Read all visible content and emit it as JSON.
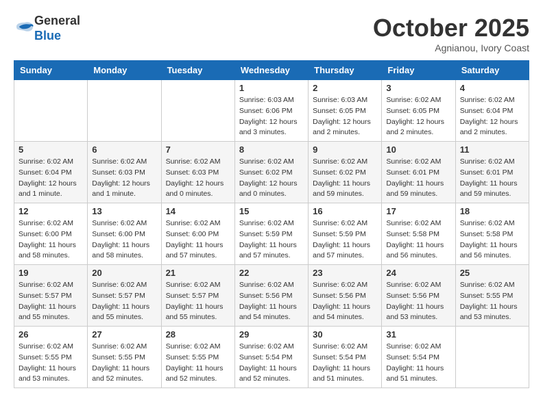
{
  "header": {
    "logo_general": "General",
    "logo_blue": "Blue",
    "month": "October 2025",
    "location": "Agnianou, Ivory Coast"
  },
  "weekdays": [
    "Sunday",
    "Monday",
    "Tuesday",
    "Wednesday",
    "Thursday",
    "Friday",
    "Saturday"
  ],
  "weeks": [
    [
      {
        "day": "",
        "info": ""
      },
      {
        "day": "",
        "info": ""
      },
      {
        "day": "",
        "info": ""
      },
      {
        "day": "1",
        "info": "Sunrise: 6:03 AM\nSunset: 6:06 PM\nDaylight: 12 hours\nand 3 minutes."
      },
      {
        "day": "2",
        "info": "Sunrise: 6:03 AM\nSunset: 6:05 PM\nDaylight: 12 hours\nand 2 minutes."
      },
      {
        "day": "3",
        "info": "Sunrise: 6:02 AM\nSunset: 6:05 PM\nDaylight: 12 hours\nand 2 minutes."
      },
      {
        "day": "4",
        "info": "Sunrise: 6:02 AM\nSunset: 6:04 PM\nDaylight: 12 hours\nand 2 minutes."
      }
    ],
    [
      {
        "day": "5",
        "info": "Sunrise: 6:02 AM\nSunset: 6:04 PM\nDaylight: 12 hours\nand 1 minute."
      },
      {
        "day": "6",
        "info": "Sunrise: 6:02 AM\nSunset: 6:03 PM\nDaylight: 12 hours\nand 1 minute."
      },
      {
        "day": "7",
        "info": "Sunrise: 6:02 AM\nSunset: 6:03 PM\nDaylight: 12 hours\nand 0 minutes."
      },
      {
        "day": "8",
        "info": "Sunrise: 6:02 AM\nSunset: 6:02 PM\nDaylight: 12 hours\nand 0 minutes."
      },
      {
        "day": "9",
        "info": "Sunrise: 6:02 AM\nSunset: 6:02 PM\nDaylight: 11 hours\nand 59 minutes."
      },
      {
        "day": "10",
        "info": "Sunrise: 6:02 AM\nSunset: 6:01 PM\nDaylight: 11 hours\nand 59 minutes."
      },
      {
        "day": "11",
        "info": "Sunrise: 6:02 AM\nSunset: 6:01 PM\nDaylight: 11 hours\nand 59 minutes."
      }
    ],
    [
      {
        "day": "12",
        "info": "Sunrise: 6:02 AM\nSunset: 6:00 PM\nDaylight: 11 hours\nand 58 minutes."
      },
      {
        "day": "13",
        "info": "Sunrise: 6:02 AM\nSunset: 6:00 PM\nDaylight: 11 hours\nand 58 minutes."
      },
      {
        "day": "14",
        "info": "Sunrise: 6:02 AM\nSunset: 6:00 PM\nDaylight: 11 hours\nand 57 minutes."
      },
      {
        "day": "15",
        "info": "Sunrise: 6:02 AM\nSunset: 5:59 PM\nDaylight: 11 hours\nand 57 minutes."
      },
      {
        "day": "16",
        "info": "Sunrise: 6:02 AM\nSunset: 5:59 PM\nDaylight: 11 hours\nand 57 minutes."
      },
      {
        "day": "17",
        "info": "Sunrise: 6:02 AM\nSunset: 5:58 PM\nDaylight: 11 hours\nand 56 minutes."
      },
      {
        "day": "18",
        "info": "Sunrise: 6:02 AM\nSunset: 5:58 PM\nDaylight: 11 hours\nand 56 minutes."
      }
    ],
    [
      {
        "day": "19",
        "info": "Sunrise: 6:02 AM\nSunset: 5:57 PM\nDaylight: 11 hours\nand 55 minutes."
      },
      {
        "day": "20",
        "info": "Sunrise: 6:02 AM\nSunset: 5:57 PM\nDaylight: 11 hours\nand 55 minutes."
      },
      {
        "day": "21",
        "info": "Sunrise: 6:02 AM\nSunset: 5:57 PM\nDaylight: 11 hours\nand 55 minutes."
      },
      {
        "day": "22",
        "info": "Sunrise: 6:02 AM\nSunset: 5:56 PM\nDaylight: 11 hours\nand 54 minutes."
      },
      {
        "day": "23",
        "info": "Sunrise: 6:02 AM\nSunset: 5:56 PM\nDaylight: 11 hours\nand 54 minutes."
      },
      {
        "day": "24",
        "info": "Sunrise: 6:02 AM\nSunset: 5:56 PM\nDaylight: 11 hours\nand 53 minutes."
      },
      {
        "day": "25",
        "info": "Sunrise: 6:02 AM\nSunset: 5:55 PM\nDaylight: 11 hours\nand 53 minutes."
      }
    ],
    [
      {
        "day": "26",
        "info": "Sunrise: 6:02 AM\nSunset: 5:55 PM\nDaylight: 11 hours\nand 53 minutes."
      },
      {
        "day": "27",
        "info": "Sunrise: 6:02 AM\nSunset: 5:55 PM\nDaylight: 11 hours\nand 52 minutes."
      },
      {
        "day": "28",
        "info": "Sunrise: 6:02 AM\nSunset: 5:55 PM\nDaylight: 11 hours\nand 52 minutes."
      },
      {
        "day": "29",
        "info": "Sunrise: 6:02 AM\nSunset: 5:54 PM\nDaylight: 11 hours\nand 52 minutes."
      },
      {
        "day": "30",
        "info": "Sunrise: 6:02 AM\nSunset: 5:54 PM\nDaylight: 11 hours\nand 51 minutes."
      },
      {
        "day": "31",
        "info": "Sunrise: 6:02 AM\nSunset: 5:54 PM\nDaylight: 11 hours\nand 51 minutes."
      },
      {
        "day": "",
        "info": ""
      }
    ]
  ]
}
